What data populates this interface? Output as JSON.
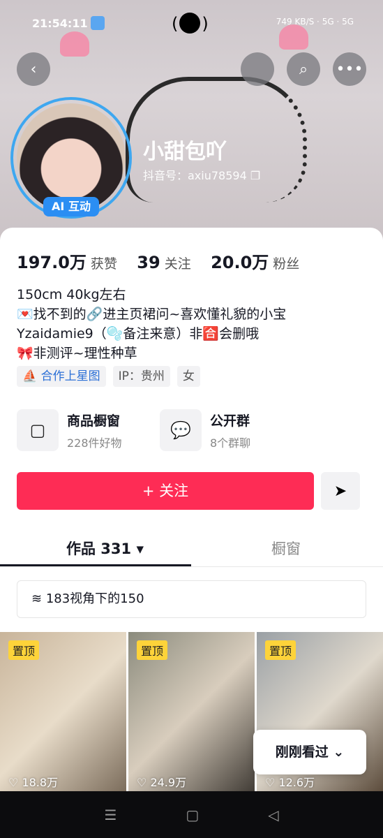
{
  "status_bar": {
    "time": "21:54:11",
    "center": "( )",
    "right_info": "749 KB/S · 5G · 5G"
  },
  "profile": {
    "name": "小甜包吖",
    "douyin_id": "抖音号：axiu78594",
    "ai_badge": "AI 互动"
  },
  "stats": [
    {
      "value": "197.0万",
      "label": "获赞"
    },
    {
      "value": "39",
      "label": "关注"
    },
    {
      "value": "20.0万",
      "label": "粉丝"
    }
  ],
  "bio": [
    "150cm 40kg左右",
    "💌找不到的🔗进主页裙问~喜欢懂礼貌的小宝",
    "Yzaidamie9（🫧备注来意）非🈴会删哦",
    "🎀非测评~理性种草"
  ],
  "tags": [
    "合作上星图",
    "IP：贵州",
    "女"
  ],
  "features": [
    {
      "title": "商品橱窗",
      "subtitle": "228件好物",
      "icon": "bag-icon"
    },
    {
      "title": "公开群",
      "subtitle": "8个群聊",
      "icon": "chat-icon"
    }
  ],
  "follow_label": "+ 关注",
  "tabs": [
    "作品 331 ▾",
    "橱窗"
  ],
  "collection_label": "183视角下的150",
  "videos": [
    {
      "pin": "置顶",
      "likes": "18.8万"
    },
    {
      "pin": "置顶",
      "likes": "24.9万"
    },
    {
      "pin": "置顶",
      "likes": "12.6万"
    }
  ],
  "recent_label": "刚刚看过 ⌄",
  "nav": [
    "☰",
    "▢",
    "◁"
  ],
  "colors": {
    "accent": "#fe2c55",
    "avatar_ring": "#3ea7f0",
    "pin": "#fdd33a"
  }
}
